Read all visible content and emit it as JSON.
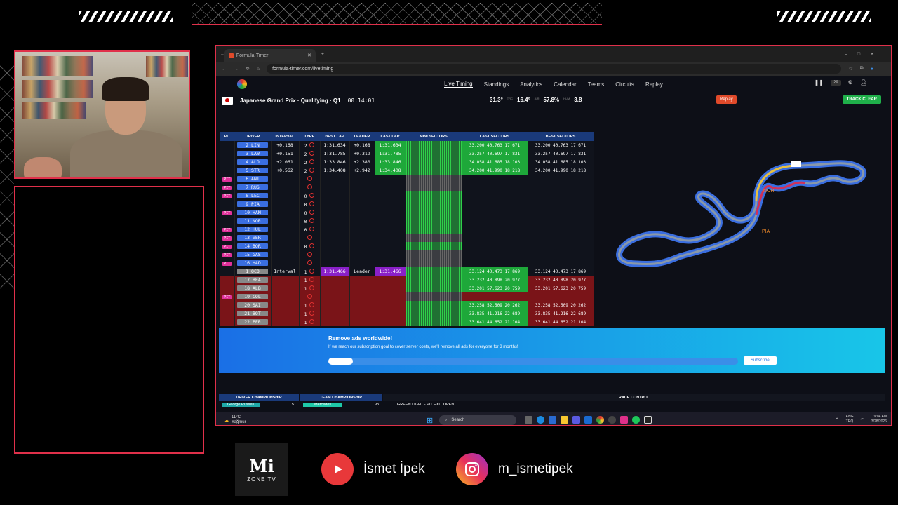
{
  "browser": {
    "tab_title": "Formula-Timer",
    "url": "formula-timer.com/livetiming"
  },
  "nav": {
    "items": [
      "Live Timing",
      "Standings",
      "Analytics",
      "Calendar",
      "Teams",
      "Circuits",
      "Replay"
    ],
    "counter": "29"
  },
  "session": {
    "title": "Japanese Grand Prix · Qualifying · Q1",
    "clock": "00:14:01",
    "track_temp": "31.3°",
    "track_temp_unit": "TRC",
    "air_temp": "16.4°",
    "air_temp_unit": "AIR",
    "humidity": "57.8%",
    "humidity_unit": "HUM",
    "wind": "3.8",
    "replay_label": "Replay",
    "track_clear_label": "TRACK CLEAR"
  },
  "table": {
    "headers": [
      "PIT",
      "DRIVER",
      "INTERVAL",
      "TYRE",
      "BEST LAP",
      "LEADER",
      "LAST LAP",
      "MINI SECTORS",
      "LAST SECTORS",
      "BEST SECTORS"
    ],
    "rows": [
      {
        "pos": "2",
        "drv": "LIN",
        "interval": "+0.168",
        "tyre": "2",
        "best": "1:31.634",
        "leader": "+0.168",
        "last": "1:31.634",
        "ls": [
          "33.200",
          "40.763",
          "17.671"
        ],
        "bs": [
          "33.200",
          "40.763",
          "17.671"
        ]
      },
      {
        "pos": "3",
        "drv": "LAW",
        "interval": "+0.151",
        "tyre": "2",
        "best": "1:31.785",
        "leader": "+0.319",
        "last": "1:31.785",
        "ls": [
          "33.257",
          "40.697",
          "17.831"
        ],
        "bs": [
          "33.257",
          "40.697",
          "17.831"
        ]
      },
      {
        "pos": "4",
        "drv": "ALO",
        "interval": "+2.061",
        "tyre": "2",
        "best": "1:33.846",
        "leader": "+2.380",
        "last": "1:33.846",
        "ls": [
          "34.058",
          "41.685",
          "18.103"
        ],
        "bs": [
          "34.058",
          "41.685",
          "18.103"
        ]
      },
      {
        "pos": "5",
        "drv": "STR",
        "interval": "+0.562",
        "tyre": "2",
        "best": "1:34.408",
        "leader": "+2.942",
        "last": "1:34.408",
        "ls": [
          "34.200",
          "41.990",
          "18.218"
        ],
        "bs": [
          "34.200",
          "41.990",
          "18.218"
        ]
      },
      {
        "pit": "PIT",
        "pos": "6",
        "drv": "ANT"
      },
      {
        "pit": "PIT",
        "pos": "7",
        "drv": "RUS"
      },
      {
        "pit": "PIT",
        "pos": "8",
        "drv": "LEC",
        "tyre": "0"
      },
      {
        "pos": "9",
        "drv": "PIA",
        "tyre": "0"
      },
      {
        "pit": "PIT",
        "pos": "10",
        "drv": "HAM",
        "tyre": "0"
      },
      {
        "pos": "11",
        "drv": "NOR",
        "tyre": "0"
      },
      {
        "pit": "PIT",
        "pos": "12",
        "drv": "HUL",
        "tyre": "0"
      },
      {
        "pit": "PIT",
        "pos": "13",
        "drv": "VER"
      },
      {
        "pit": "PIT",
        "pos": "14",
        "drv": "BOR",
        "tyre": "0"
      },
      {
        "pit": "PIT",
        "pos": "15",
        "drv": "GAS"
      },
      {
        "pit": "PIT",
        "pos": "16",
        "drv": "HAD"
      },
      {
        "pos": "1",
        "drv": "OCO",
        "interval": "Interval",
        "tyre": "1",
        "best": "1:31.466",
        "leader": "Leader",
        "last": "1:31.466",
        "ls": [
          "33.124",
          "40.473",
          "17.869"
        ],
        "bs": [
          "33.124",
          "40.473",
          "17.869"
        ],
        "ref": true
      },
      {
        "pos": "17",
        "drv": "BEA",
        "tyre": "1",
        "ls": [
          "33.232",
          "40.898",
          "20.977"
        ],
        "bs": [
          "33.232",
          "40.898",
          "20.977"
        ],
        "red": true
      },
      {
        "pos": "18",
        "drv": "ALB",
        "tyre": "1",
        "ls": [
          "33.201",
          "57.623",
          "20.759"
        ],
        "bs": [
          "33.201",
          "57.623",
          "20.759"
        ],
        "red": true
      },
      {
        "pit": "PIT",
        "pos": "19",
        "drv": "COL",
        "red": true
      },
      {
        "pos": "20",
        "drv": "SAI",
        "tyre": "1",
        "ls": [
          "33.258",
          "52.509",
          "20.262"
        ],
        "bs": [
          "33.258",
          "52.509",
          "20.262"
        ],
        "red": true
      },
      {
        "pos": "21",
        "drv": "BOT",
        "tyre": "1",
        "ls": [
          "33.835",
          "41.216",
          "22.689"
        ],
        "bs": [
          "33.835",
          "41.216",
          "22.689"
        ],
        "red": true
      },
      {
        "pos": "22",
        "drv": "PER",
        "tyre": "1",
        "ls": [
          "33.641",
          "44.652",
          "21.104"
        ],
        "bs": [
          "33.641",
          "44.652",
          "21.104"
        ],
        "red": true
      }
    ]
  },
  "map": {
    "labels": [
      "NOR",
      "PIA"
    ]
  },
  "ad": {
    "title": "Remove ads worldwide!",
    "text": "If we reach our subscription goal to cover server costs, we'll remove all ads for everyone for 3 months!",
    "progress": 0.06,
    "button": "Subscribe"
  },
  "bottom": {
    "driver_champ": "DRIVER CHAMPIONSHIP",
    "team_champ": "TEAM CHAMPIONSHIP",
    "race_control": "RACE CONTROL",
    "driver_row": "George Russell",
    "driver_pts": "51",
    "team_row": "Mercedes",
    "team_pts": "98",
    "rc_msg": "GREEN LIGHT - PIT EXIT OPEN"
  },
  "taskbar": {
    "temp": "11°C",
    "weather": "Yağmur",
    "search": "Search",
    "lang": "ENG",
    "region": "TRQ",
    "time": "9:04 AM",
    "date": "3/28/2026"
  },
  "stream": {
    "brand_big": "Mi",
    "brand_small": "ZONE TV",
    "youtube": "İsmet İpek",
    "instagram": "m_ismetipek"
  },
  "colors": {
    "frame": "#e0304a",
    "header": "#1a3a7a",
    "purple": "#8a20c8",
    "green": "#1ea83a"
  }
}
